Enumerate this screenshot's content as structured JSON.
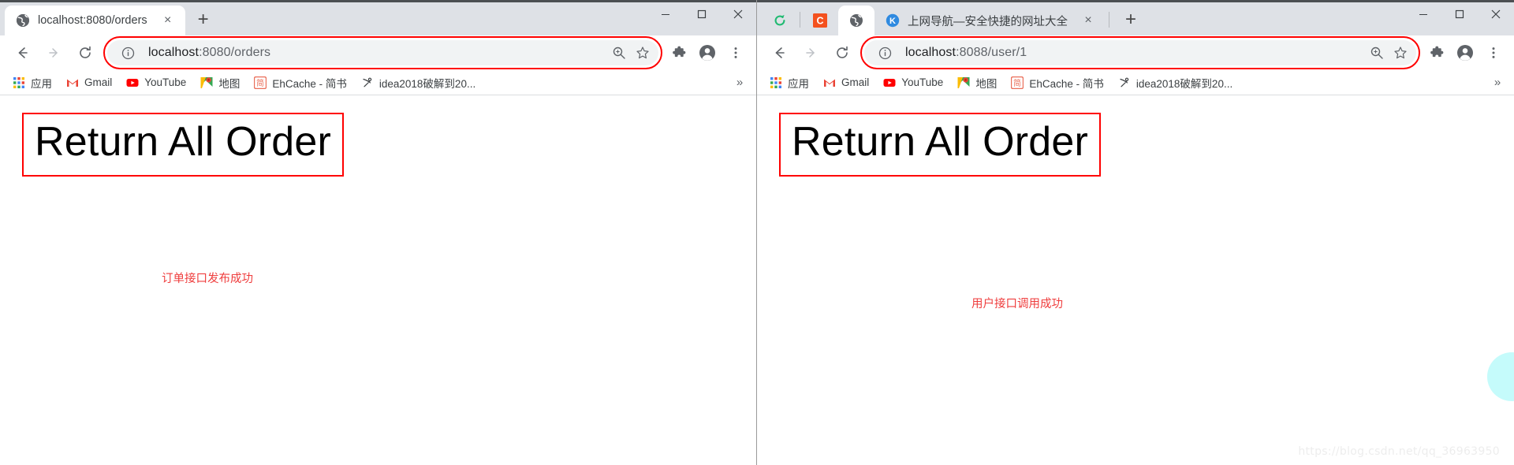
{
  "watermark": "https://blog.csdn.net/qq_36963950",
  "left_window": {
    "tabs": [
      {
        "label": "localhost:8080/orders",
        "favicon": "globe-icon",
        "active": true
      }
    ],
    "new_tab_label": "+",
    "close_tab_label": "×",
    "window_controls": {
      "minimize": "—",
      "maximize": "□",
      "close": "×"
    },
    "toolbar": {
      "back": "back-arrow",
      "forward": "forward-arrow",
      "reload": "reload-arrow",
      "info_icon": "info-circle-icon",
      "url_scheme": "localhost",
      "url_port": ":8080",
      "url_path": "/orders",
      "url_full": "localhost:8080/orders",
      "zoom_icon": "zoom-magnifier-icon",
      "star_icon": "bookmark-star-icon",
      "extensions_icon": "puzzle-piece-icon",
      "profile_icon": "profile-avatar-icon",
      "menu_icon": "three-dot-menu-icon"
    },
    "bookmarks": [
      {
        "label": "应用",
        "icon": "apps-grid-icon"
      },
      {
        "label": "Gmail",
        "icon": "gmail-icon"
      },
      {
        "label": "YouTube",
        "icon": "youtube-icon"
      },
      {
        "label": "地图",
        "icon": "maps-icon"
      },
      {
        "label": "EhCache - 简书",
        "icon": "jianshu-icon"
      },
      {
        "label": "idea2018破解到20...",
        "icon": "anchor-icon"
      }
    ],
    "bookmarks_overflow": "»",
    "page": {
      "heading": "Return All Order",
      "note": "订单接口发布成功"
    }
  },
  "right_window": {
    "pinned_tabs": [
      {
        "label": "",
        "favicon": "green-refresh-icon"
      },
      {
        "label": "",
        "favicon": "c-orange-icon"
      },
      {
        "label": "",
        "favicon": "globe-icon"
      }
    ],
    "tabs": [
      {
        "label": "上网导航—安全快捷的网址大全",
        "favicon": "kuaisou-blue-icon",
        "active": true
      }
    ],
    "new_tab_label": "+",
    "close_tab_label": "×",
    "window_controls": {
      "minimize": "—",
      "maximize": "□",
      "close": "×"
    },
    "toolbar": {
      "back": "back-arrow",
      "forward": "forward-arrow",
      "reload": "reload-arrow",
      "info_icon": "info-circle-icon",
      "url_scheme": "localhost",
      "url_port": ":8088",
      "url_path": "/user/1",
      "url_full": "localhost:8088/user/1",
      "zoom_icon": "zoom-magnifier-icon",
      "star_icon": "bookmark-star-icon",
      "extensions_icon": "puzzle-piece-icon",
      "profile_icon": "profile-avatar-icon",
      "menu_icon": "three-dot-menu-icon"
    },
    "bookmarks": [
      {
        "label": "应用",
        "icon": "apps-grid-icon"
      },
      {
        "label": "Gmail",
        "icon": "gmail-icon"
      },
      {
        "label": "YouTube",
        "icon": "youtube-icon"
      },
      {
        "label": "地图",
        "icon": "maps-icon"
      },
      {
        "label": "EhCache - 简书",
        "icon": "jianshu-icon"
      },
      {
        "label": "idea2018破解到20...",
        "icon": "anchor-icon"
      }
    ],
    "bookmarks_overflow": "»",
    "page": {
      "heading": "Return All Order",
      "note": "用户接口调用成功"
    }
  },
  "colors": {
    "highlight_red": "#ff0000",
    "note_red": "#ef3d3d",
    "tabstrip_bg": "#dee1e6",
    "omnibox_bg": "#f1f3f4",
    "cyan_blob": "#c5fbfb"
  }
}
